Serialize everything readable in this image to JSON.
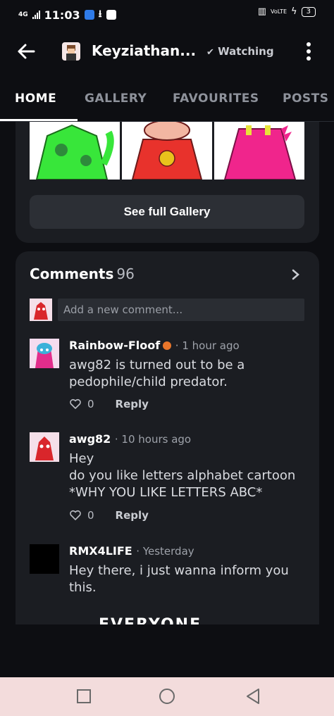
{
  "status": {
    "network": "4G",
    "time": "11:03",
    "lte": "VoLTE",
    "battery": "3"
  },
  "header": {
    "title": "Keyziathan...",
    "watching_label": "Watching"
  },
  "tabs": [
    {
      "label": "HOME",
      "active": true
    },
    {
      "label": "GALLERY",
      "active": false
    },
    {
      "label": "FAVOURITES",
      "active": false
    },
    {
      "label": "POSTS",
      "active": false
    }
  ],
  "gallery": {
    "see_full_label": "See full Gallery"
  },
  "comments": {
    "title": "Comments",
    "count": "96",
    "add_placeholder": "Add a new comment...",
    "items": [
      {
        "author": "Rainbow-Floof",
        "time": "· 1 hour ago",
        "body": "awg82 is turned out to be a pedophile/child predator.",
        "likes": "0",
        "reply": "Reply"
      },
      {
        "author": "awg82",
        "time": "· 10 hours ago",
        "body": "Hey\ndo you like letters alphabet cartoon\n*WHY YOU LIKE LETTERS ABC*",
        "likes": "0",
        "reply": "Reply"
      },
      {
        "author": "RMX4LIFE",
        "time": "· Yesterday",
        "body": "Hey there, i just wanna inform you this.",
        "partial_text": "EVERYONE"
      }
    ]
  },
  "colors": {
    "background": "#0d0e12",
    "card": "#1b1d22",
    "button": "#2c2f35",
    "navbar": "#f3dcdc",
    "badge": "#e9762b"
  },
  "icons": {
    "back": "arrow-left-icon",
    "watching": "check-icon",
    "more": "more-vertical-icon",
    "chevron": "chevron-right-icon",
    "like": "heart-icon",
    "nav_recent": "square-icon",
    "nav_home": "circle-icon",
    "nav_back": "triangle-back-icon"
  }
}
